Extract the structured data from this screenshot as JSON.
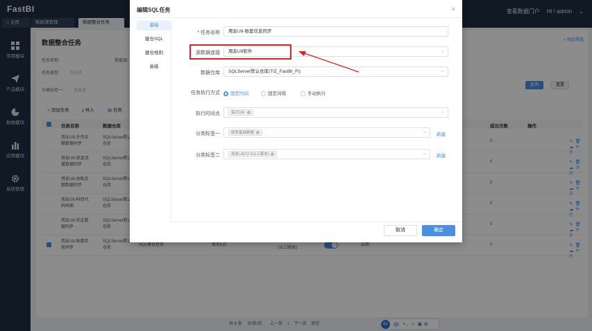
{
  "app": {
    "title": "FastBI",
    "portal_link": "查看数据门户",
    "user_greeting": "Hi ! admin"
  },
  "tabs": [
    {
      "label": "主页"
    },
    {
      "label": "数据源管理"
    },
    {
      "label": "数据整合任务"
    }
  ],
  "sidebar": {
    "items": [
      {
        "label": "常用模块",
        "icon": "grid-icon"
      },
      {
        "label": "产品模块",
        "icon": "paper-plane-icon"
      },
      {
        "label": "数据模块",
        "icon": "pie-chart-icon"
      },
      {
        "label": "应用模块",
        "icon": "bar-chart-icon"
      },
      {
        "label": "系统管理",
        "icon": "gear-icon"
      }
    ]
  },
  "page": {
    "title": "数据整合任务",
    "collapse_label": "« 收起筛选",
    "filters": [
      {
        "label": "任务名称:",
        "placeholder": ""
      },
      {
        "label": "数据源:",
        "placeholder": ""
      },
      {
        "label": "任务类型:",
        "placeholder": "请选择"
      },
      {
        "label": "分类标签一:",
        "placeholder": "请选择"
      }
    ],
    "search_button": "查询",
    "reset_button": "重置",
    "toolbar": {
      "add": "添加任务",
      "import": "导入",
      "tasks": "任务"
    },
    "columns": [
      "任务名称",
      "数据仓库",
      "成功次数",
      "操作"
    ],
    "rows": [
      {
        "name": "用友U8-外币余额数据同步",
        "warehouse": "SQLServer默认仓库",
        "success": "0"
      },
      {
        "name": "用友U8-现金流量数据同步",
        "warehouse": "SQLServer默认仓库",
        "success": "0"
      },
      {
        "name": "用友U8-总账余额数据同步",
        "warehouse": "SQLServer默认仓库",
        "success": "0"
      },
      {
        "name": "用友U8-科目代码档案",
        "warehouse": "SQLServer默认仓库",
        "success": "0"
      },
      {
        "name": "用友U8-凭证数据同步",
        "warehouse": "SQLServer默认仓库",
        "success": "0"
      },
      {
        "name": "用友U8-账套信息同步",
        "warehouse": "SQLServer默认仓库",
        "type": "SQL建仓任务",
        "cron": "每天0点",
        "tag": "(以上版本)",
        "status": "启用",
        "success": "0"
      }
    ],
    "pagination": {
      "total": "共 6 条",
      "page_size": "50条/页",
      "prev": "上一页",
      "current": "1",
      "next": "下一页",
      "goto": "前往"
    }
  },
  "modal": {
    "title": "编辑SQL任务",
    "close": "×",
    "nav": [
      "基础",
      "建仓SQL",
      "建仓规则",
      "高级"
    ],
    "fields": {
      "task_name": {
        "label": "* 任务名称",
        "value": "用友U8-账套信息同步"
      },
      "source": {
        "label": "源数据连接",
        "value": "用友U8软件"
      },
      "warehouse": {
        "label": "数据仓库",
        "value": "SQLServer默认仓库(TIZ_FastBI_FI)"
      },
      "exec_mode": {
        "label": "任务执行方式",
        "options": [
          "固定时间",
          "固定间隔",
          "手动执行"
        ],
        "selected": 0
      },
      "exec_time": {
        "label": "执行时间点",
        "tag": "每天0点"
      },
      "tag1": {
        "label": "分类标签一",
        "tag": "财务基础数据",
        "new": "新建"
      },
      "tag2": {
        "label": "分类标签二",
        "tag": "用友U8(12.0以上版本)",
        "new": "新建"
      }
    },
    "cancel": "取消",
    "ok": "确定"
  },
  "ime": {
    "label": "中"
  },
  "colors": {
    "accent": "#4a90e2",
    "highlight": "#e02020",
    "dark": "#1e2f43"
  }
}
